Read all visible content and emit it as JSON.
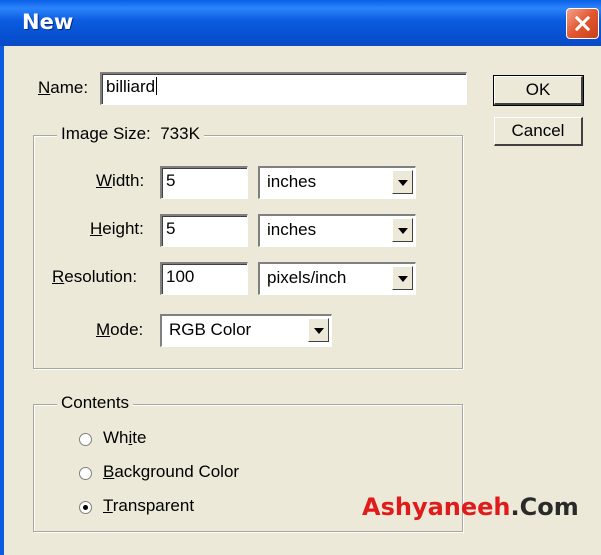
{
  "window": {
    "title": "New"
  },
  "name": {
    "label_prefix": "",
    "label_mnemonic": "N",
    "label_rest": "ame:",
    "value": "billiard"
  },
  "buttons": {
    "ok": "OK",
    "cancel": "Cancel"
  },
  "image_size": {
    "label": "Image Size:",
    "value": "733K",
    "width": {
      "label_mnemonic": "W",
      "label_rest": "idth:",
      "value": "5",
      "unit": "inches"
    },
    "height": {
      "label_mnemonic": "H",
      "label_rest": "eight:",
      "value": "5",
      "unit": "inches"
    },
    "resolution": {
      "label_mnemonic": "R",
      "label_rest": "esolution:",
      "value": "100",
      "unit": "pixels/inch"
    },
    "mode": {
      "label_mnemonic": "M",
      "label_rest": "ode:",
      "value": "RGB Color"
    }
  },
  "contents": {
    "label": "Contents",
    "options": [
      {
        "pre": "Wh",
        "mnemonic": "i",
        "post": "te",
        "checked": false
      },
      {
        "pre": "",
        "mnemonic": "B",
        "post": "ackground Color",
        "checked": false
      },
      {
        "pre": "",
        "mnemonic": "T",
        "post": "ransparent",
        "checked": true
      }
    ]
  },
  "watermark": {
    "part1": "Ashyaneeh",
    "part2": ".Com"
  }
}
